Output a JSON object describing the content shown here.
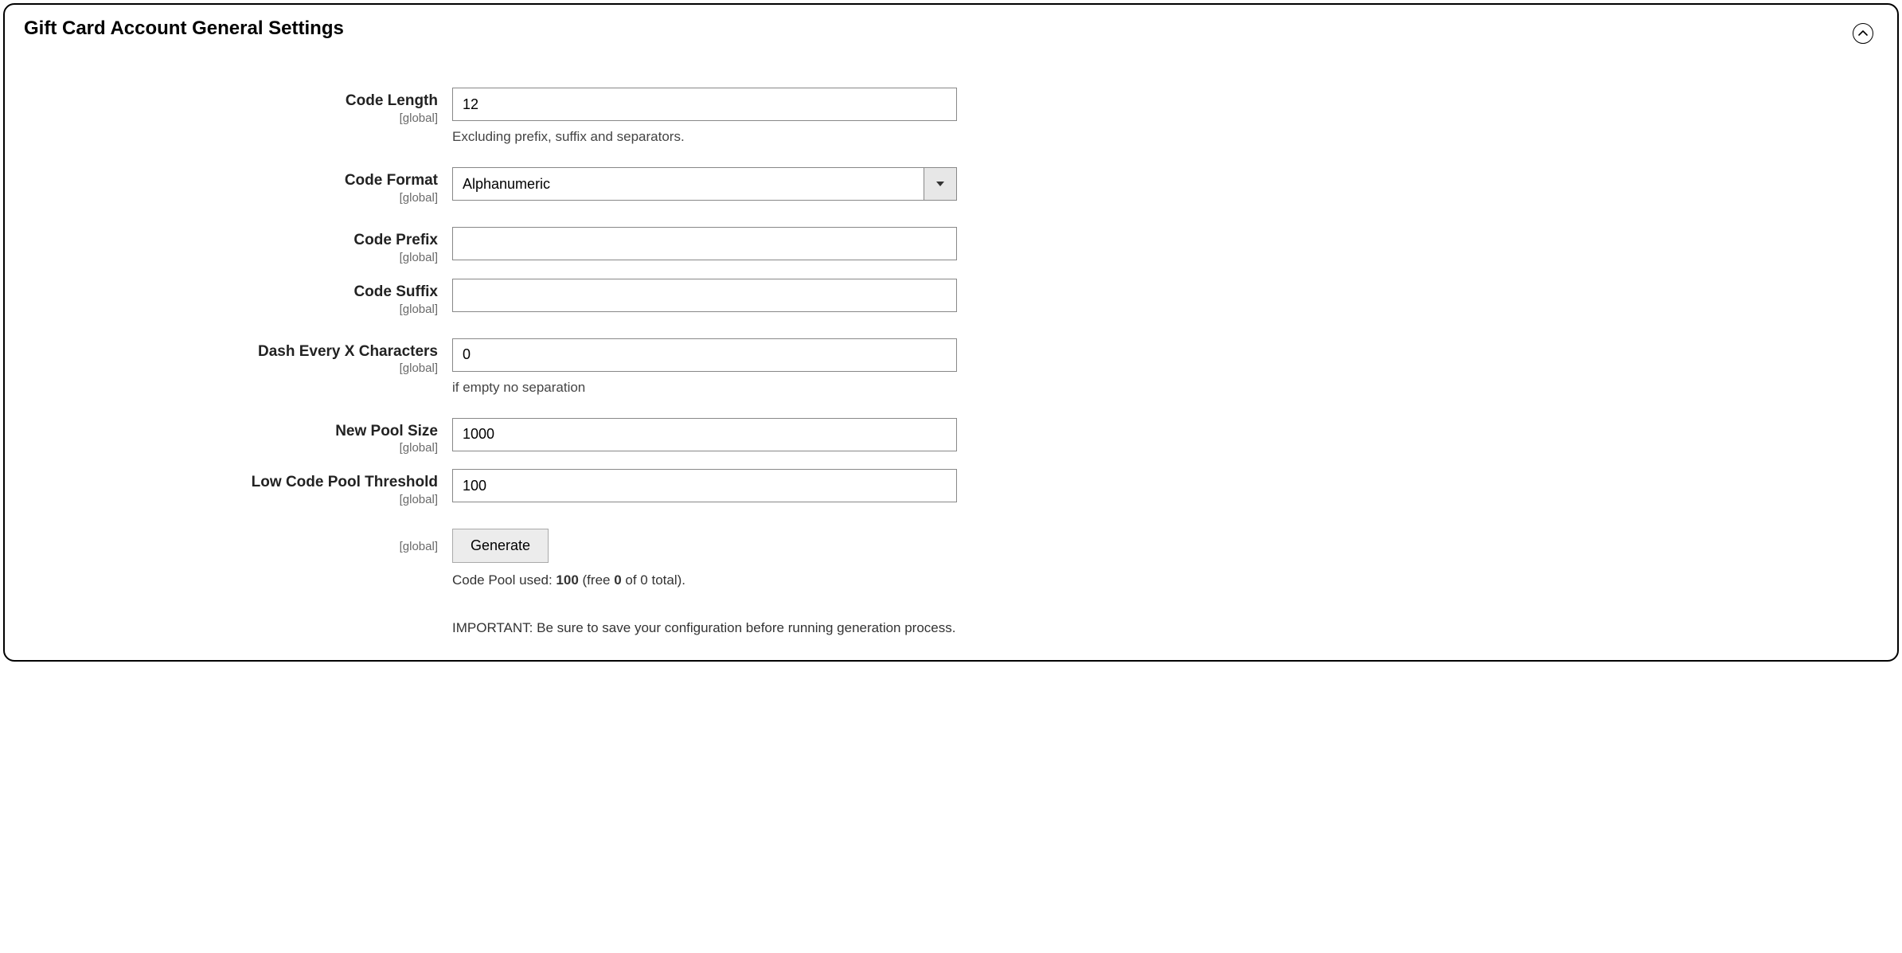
{
  "panel": {
    "title": "Gift Card Account General Settings"
  },
  "scope": "[global]",
  "fields": {
    "code_length": {
      "label": "Code Length",
      "value": "12",
      "helper": "Excluding prefix, suffix and separators."
    },
    "code_format": {
      "label": "Code Format",
      "value": "Alphanumeric"
    },
    "code_prefix": {
      "label": "Code Prefix",
      "value": ""
    },
    "code_suffix": {
      "label": "Code Suffix",
      "value": ""
    },
    "dash_every": {
      "label": "Dash Every X Characters",
      "value": "0",
      "helper": "if empty no separation"
    },
    "new_pool_size": {
      "label": "New Pool Size",
      "value": "1000"
    },
    "low_threshold": {
      "label": "Low Code Pool Threshold",
      "value": "100"
    },
    "generate": {
      "button": "Generate",
      "status_prefix": "Code Pool used: ",
      "status_used": "100",
      "status_mid1": " (free ",
      "status_free": "0",
      "status_mid2": " of 0 total).",
      "important": "IMPORTANT: Be sure to save your configuration before running generation process."
    }
  }
}
